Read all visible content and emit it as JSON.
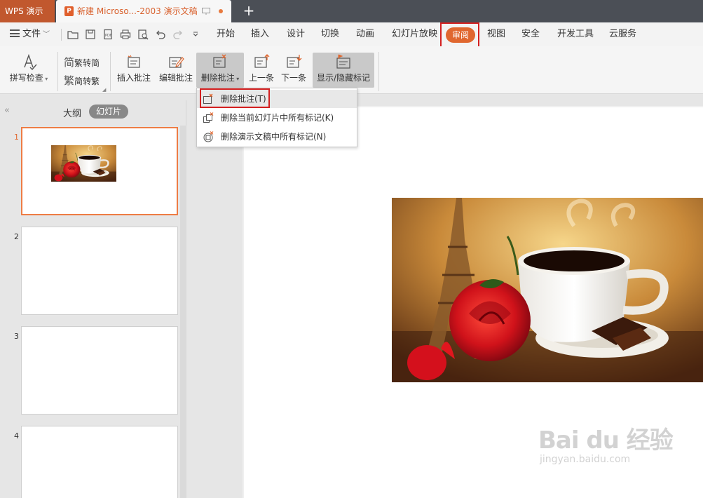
{
  "titlebar": {
    "app_tab": "WPS 演示",
    "doc_tab": "新建 Microso...-2003 演示文稿",
    "new_tab": "+"
  },
  "menubar": {
    "file_label": "文件",
    "tabs": [
      "开始",
      "插入",
      "设计",
      "切换",
      "动画",
      "幻灯片放映",
      "审阅",
      "视图",
      "安全",
      "开发工具",
      "云服务"
    ],
    "active_tab": "审阅",
    "accent": "#e0672f"
  },
  "ribbon": {
    "spell_check": "拼写检查",
    "trad_to_simp": "繁转简",
    "simp_to_trad": "简转繁",
    "insert_comment": "插入批注",
    "edit_comment": "编辑批注",
    "delete_comment": "删除批注",
    "prev": "上一条",
    "next": "下一条",
    "show_hide_markup": "显示/隐藏标记"
  },
  "dropdown": {
    "items": [
      "删除批注(T)",
      "删除当前幻灯片中所有标记(K)",
      "删除演示文稿中所有标记(N)"
    ]
  },
  "left_panel": {
    "outline_tab": "大纲",
    "slides_tab": "幻灯片",
    "slide_numbers": [
      "1",
      "2",
      "3",
      "4"
    ]
  },
  "watermark": {
    "main": "Bai du 经验",
    "sub": "jingyan.baidu.com"
  },
  "highlight_color": "#d42020"
}
